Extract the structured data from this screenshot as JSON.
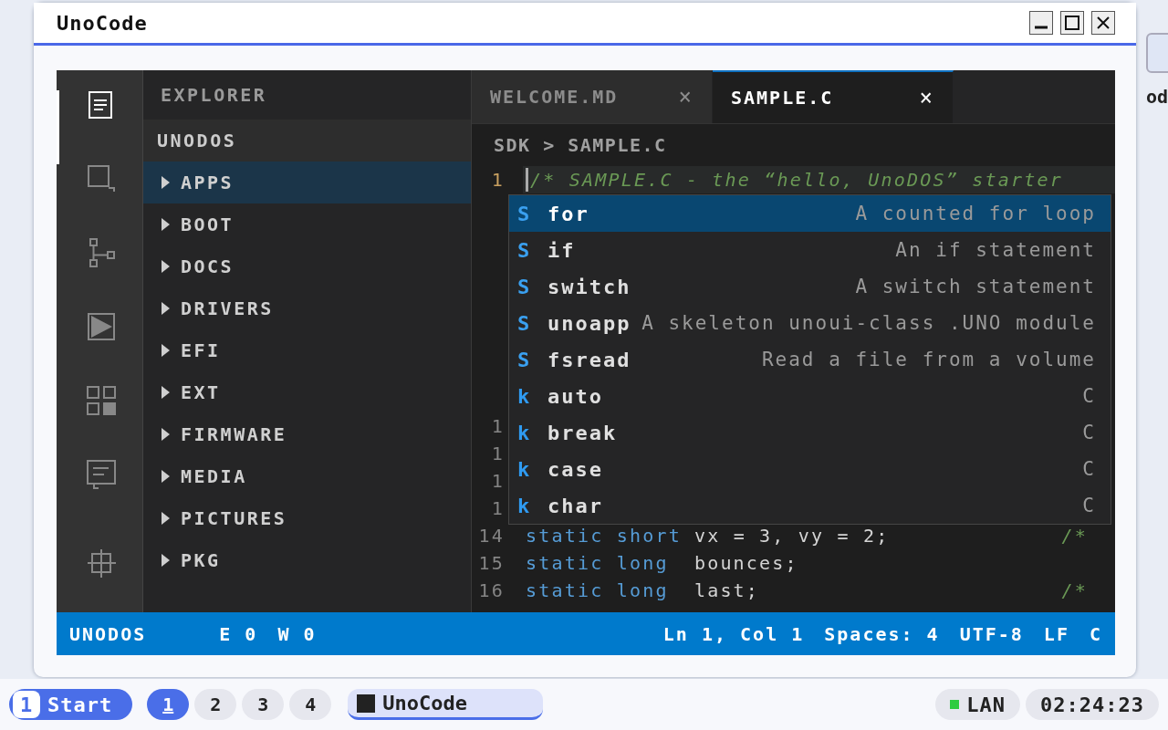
{
  "window": {
    "title": "UnoCode"
  },
  "activity_bar": {
    "items": [
      {
        "selected": true
      },
      {
        "selected": false
      },
      {
        "selected": false
      },
      {
        "selected": false
      },
      {
        "selected": false
      },
      {
        "selected": false
      },
      {
        "selected": false
      }
    ]
  },
  "sidebar": {
    "title": "EXPLORER",
    "section": "UNODOS",
    "items": [
      {
        "label": "APPS",
        "selected": true,
        "expanded": false
      },
      {
        "label": "BOOT",
        "selected": false,
        "expanded": false
      },
      {
        "label": "DOCS",
        "selected": false,
        "expanded": false
      },
      {
        "label": "DRIVERS",
        "selected": false,
        "expanded": false
      },
      {
        "label": "EFI",
        "selected": false,
        "expanded": false
      },
      {
        "label": "EXT",
        "selected": false,
        "expanded": false
      },
      {
        "label": "FIRMWARE",
        "selected": false,
        "expanded": false
      },
      {
        "label": "MEDIA",
        "selected": false,
        "expanded": false
      },
      {
        "label": "PICTURES",
        "selected": false,
        "expanded": false
      },
      {
        "label": "PKG",
        "selected": false,
        "expanded": false
      }
    ]
  },
  "tabs": [
    {
      "label": "WELCOME.MD",
      "close": "×",
      "selected": false
    },
    {
      "label": "SAMPLE.C",
      "close": "×",
      "selected": true
    }
  ],
  "breadcrumb": "SDK > SAMPLE.C",
  "code_lines": [
    {
      "number": "1",
      "current": true,
      "tokens": [
        {
          "kind": "comment",
          "text": "/* SAMPLE.C - the “hello, UnoDOS” starter"
        }
      ]
    },
    {
      "number": "1",
      "current": false
    },
    {
      "number": "1",
      "current": false
    },
    {
      "number": "1",
      "current": false
    },
    {
      "number": "1",
      "current": false
    },
    {
      "number": "14",
      "current": false,
      "tokens": [
        {
          "kind": "keyword",
          "text": "static short"
        },
        {
          "kind": "text",
          "text": "vx = 3, vy = 2;"
        }
      ],
      "trail": "/*"
    },
    {
      "number": "15",
      "current": false,
      "tokens": [
        {
          "kind": "keyword",
          "text": "static long"
        },
        {
          "kind": "text",
          "text": " bounces;"
        }
      ]
    },
    {
      "number": "16",
      "current": false,
      "tokens": [
        {
          "kind": "keyword",
          "text": "static long"
        },
        {
          "kind": "text",
          "text": " last;"
        }
      ],
      "trail": "/*"
    }
  ],
  "suggestions": [
    {
      "kind": "snippet",
      "icon": "S",
      "label": "for",
      "detail": "A counted for loop",
      "selected": true
    },
    {
      "kind": "snippet",
      "icon": "S",
      "label": "if",
      "detail": "An if statement",
      "selected": false
    },
    {
      "kind": "snippet",
      "icon": "S",
      "label": "switch",
      "detail": "A switch statement",
      "selected": false
    },
    {
      "kind": "snippet",
      "icon": "S",
      "label": "unoapp",
      "detail": "A skeleton unoui-class .UNO module",
      "selected": false
    },
    {
      "kind": "snippet",
      "icon": "S",
      "label": "fsread",
      "detail": "Read a file from a volume",
      "selected": false
    },
    {
      "kind": "keyword",
      "icon": "k",
      "label": "auto",
      "detail": "C",
      "selected": false
    },
    {
      "kind": "keyword",
      "icon": "k",
      "label": "break",
      "detail": "C",
      "selected": false
    },
    {
      "kind": "keyword",
      "icon": "k",
      "label": "case",
      "detail": "C",
      "selected": false
    },
    {
      "kind": "keyword",
      "icon": "k",
      "label": "char",
      "detail": "C",
      "selected": false
    }
  ],
  "status_bar": {
    "left": [
      "UNODOS",
      "E 0",
      "W 0"
    ],
    "right": [
      "Ln 1, Col 1",
      "Spaces: 4",
      "UTF-8",
      "LF",
      "C"
    ]
  },
  "desktop_icon": {
    "label": "od"
  },
  "taskbar": {
    "start": {
      "icon": "1",
      "label": "Start"
    },
    "workspaces": [
      {
        "label": "1",
        "selected": true
      },
      {
        "label": "2",
        "selected": false
      },
      {
        "label": "3",
        "selected": false
      },
      {
        "label": "4",
        "selected": false
      }
    ],
    "task": {
      "label": "UnoCode",
      "selected": true
    },
    "network": {
      "label": "LAN",
      "color": "#2ecc40"
    },
    "clock": "02:24:23"
  }
}
